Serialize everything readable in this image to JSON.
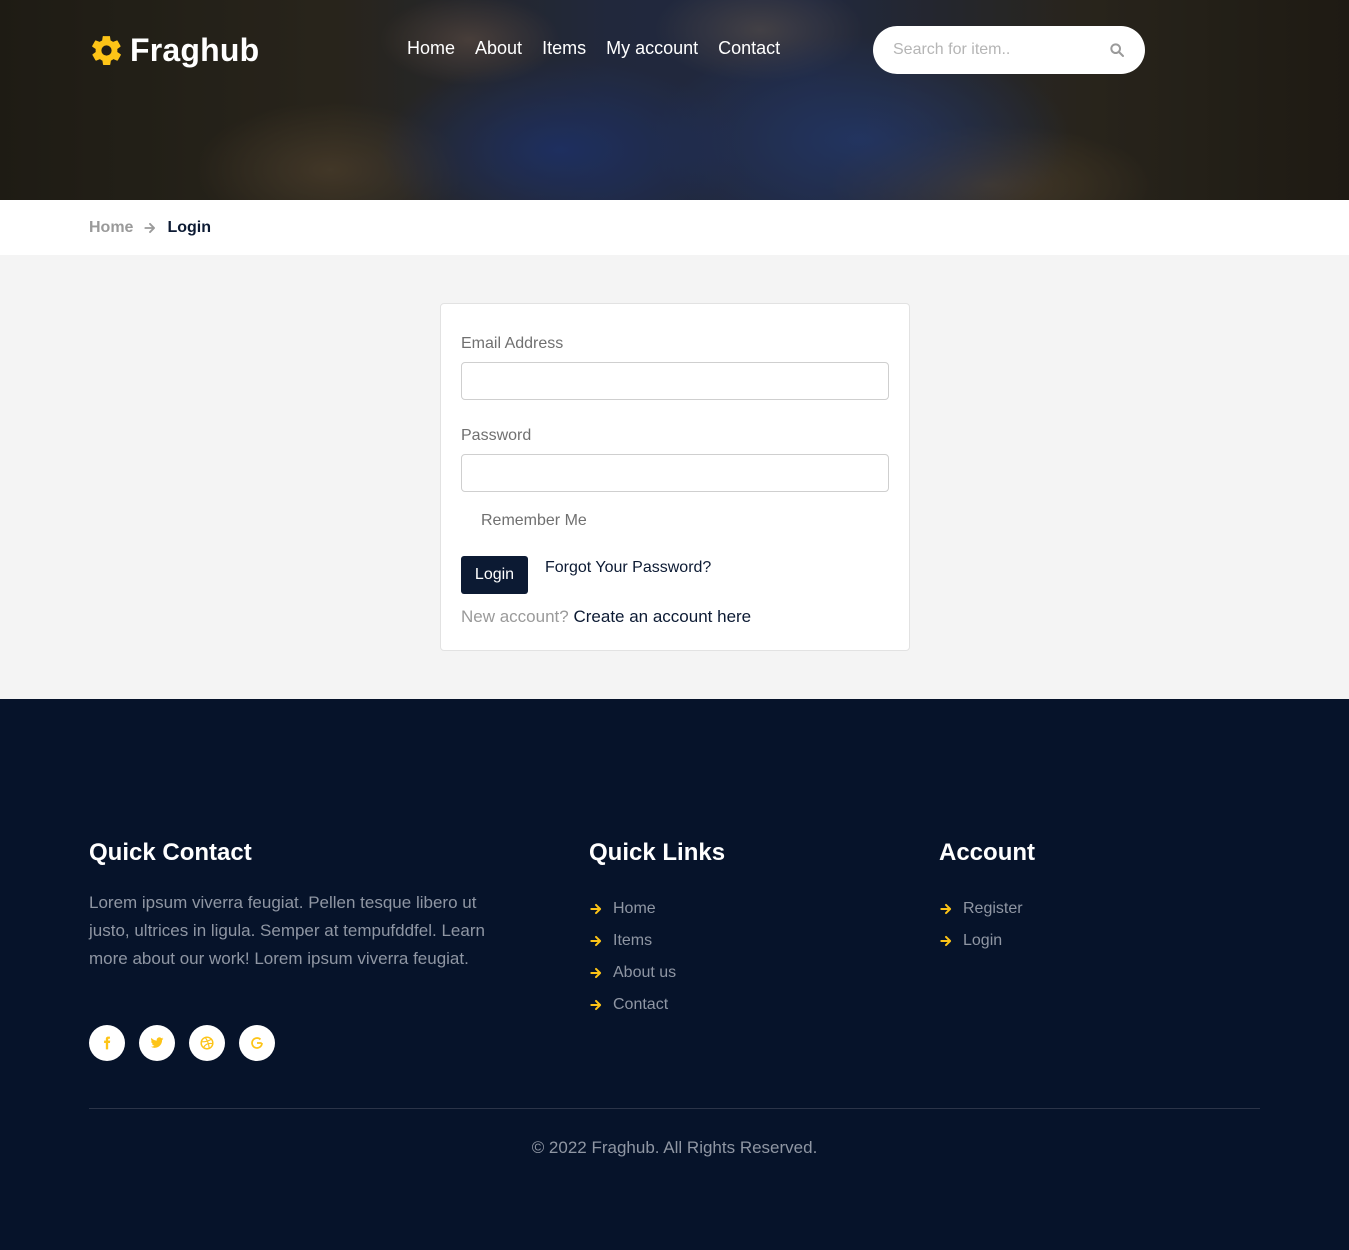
{
  "header": {
    "brand": "Fraghub",
    "nav": [
      {
        "label": "Home"
      },
      {
        "label": "About"
      },
      {
        "label": "Items"
      },
      {
        "label": "My account"
      },
      {
        "label": "Contact"
      }
    ],
    "search": {
      "placeholder": "Search for item..",
      "value": ""
    }
  },
  "breadcrumb": {
    "home": "Home",
    "current": "Login"
  },
  "login": {
    "email_label": "Email Address",
    "email_value": "",
    "password_label": "Password",
    "password_value": "",
    "remember_label": "Remember Me",
    "login_button": "Login",
    "forgot_link": "Forgot Your Password?",
    "new_account_text": "New account?",
    "create_link": "Create an account here"
  },
  "footer": {
    "quick_contact": {
      "heading": "Quick Contact",
      "text": "Lorem ipsum viverra feugiat. Pellen tesque libero ut justo, ultrices in ligula. Semper at tempufddfel. Learn more about our work! Lorem ipsum viverra feugiat.",
      "socials": [
        "facebook-icon",
        "twitter-icon",
        "dribbble-icon",
        "google-icon"
      ]
    },
    "quick_links": {
      "heading": "Quick Links",
      "items": [
        {
          "label": "Home"
        },
        {
          "label": "Items"
        },
        {
          "label": "About us"
        },
        {
          "label": "Contact"
        }
      ]
    },
    "account": {
      "heading": "Account",
      "items": [
        {
          "label": "Register"
        },
        {
          "label": "Login"
        }
      ]
    },
    "copyright": "© 2022 Fraghub. All Rights Reserved."
  },
  "colors": {
    "accent": "#fdc417",
    "navy": "#0c1a33",
    "footer_bg": "#06132a"
  }
}
